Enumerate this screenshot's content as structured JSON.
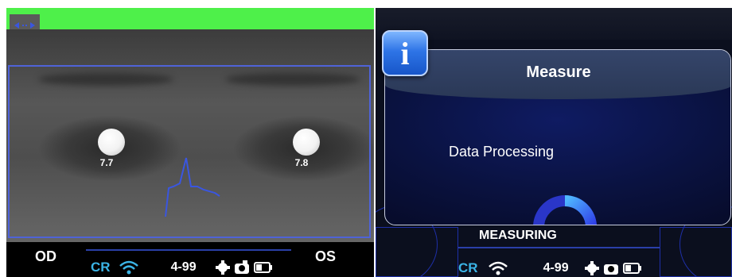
{
  "left": {
    "toggle_icon": "arrows-icon",
    "right_eye_value": "7.7",
    "left_eye_value": "7.8",
    "od_label": "OD",
    "os_label": "OS",
    "status": {
      "cr_label": "CR",
      "code": "4-99",
      "wifi_icon": "wifi-icon",
      "tool_icons": "gear-icon",
      "battery_icon": "battery-icon"
    }
  },
  "dialog": {
    "icon": "info-icon",
    "title": "Measure",
    "message": "Data Processing"
  },
  "right": {
    "measuring_label": "MEASURING",
    "status": {
      "cr_label": "CR",
      "code": "4-99"
    }
  },
  "colors": {
    "green_bar": "#4ef04a",
    "roi_border": "#4f63d8",
    "cr_accent": "#3bb4e6",
    "dialog_bg": "#0a1240",
    "spinner": "#3a4fe8"
  }
}
